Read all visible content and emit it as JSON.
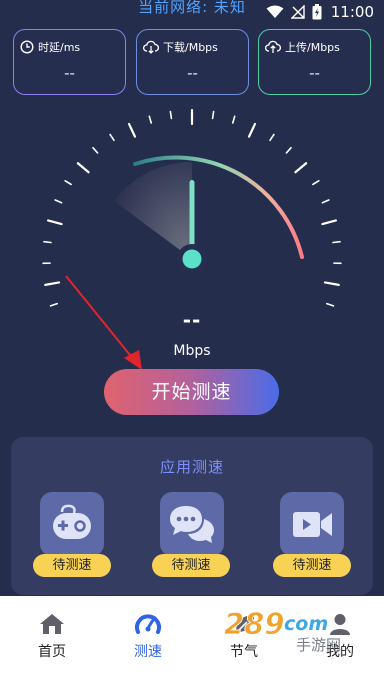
{
  "status_bar": {
    "network_title": "当前网络: 未知",
    "time": "11:00"
  },
  "metrics": [
    {
      "label": "时延/ms",
      "value": "--",
      "icon": "clock-icon"
    },
    {
      "label": "下载/Mbps",
      "value": "--",
      "icon": "cloud-download-icon"
    },
    {
      "label": "上传/Mbps",
      "value": "--",
      "icon": "cloud-upload-icon"
    }
  ],
  "gauge": {
    "speed_value": "--",
    "unit": "Mbps",
    "needle_level": 0.5
  },
  "start_button": "开始测速",
  "app_speed": {
    "title": "应用测速",
    "apps": [
      {
        "icon": "gamepad-icon",
        "status": "待测速"
      },
      {
        "icon": "chat-bubbles-icon",
        "status": "待测速"
      },
      {
        "icon": "video-camera-icon",
        "status": "待测速"
      }
    ]
  },
  "nav": {
    "items": [
      {
        "label": "首页",
        "icon": "home-icon"
      },
      {
        "label": "测速",
        "icon": "speedometer-icon"
      },
      {
        "label": "节气",
        "icon": "leaf-icon"
      },
      {
        "label": "我的",
        "icon": "user-icon"
      }
    ],
    "active_index": 1
  },
  "colors": {
    "background": "#252d4d",
    "accent_blue": "#2f64e8",
    "pill_yellow": "#f7d255",
    "button_start": "#e0636f",
    "button_end": "#4a6ce8"
  },
  "watermark": {
    "brand": "289",
    "suffix": "com",
    "subtitle": "手游网"
  }
}
